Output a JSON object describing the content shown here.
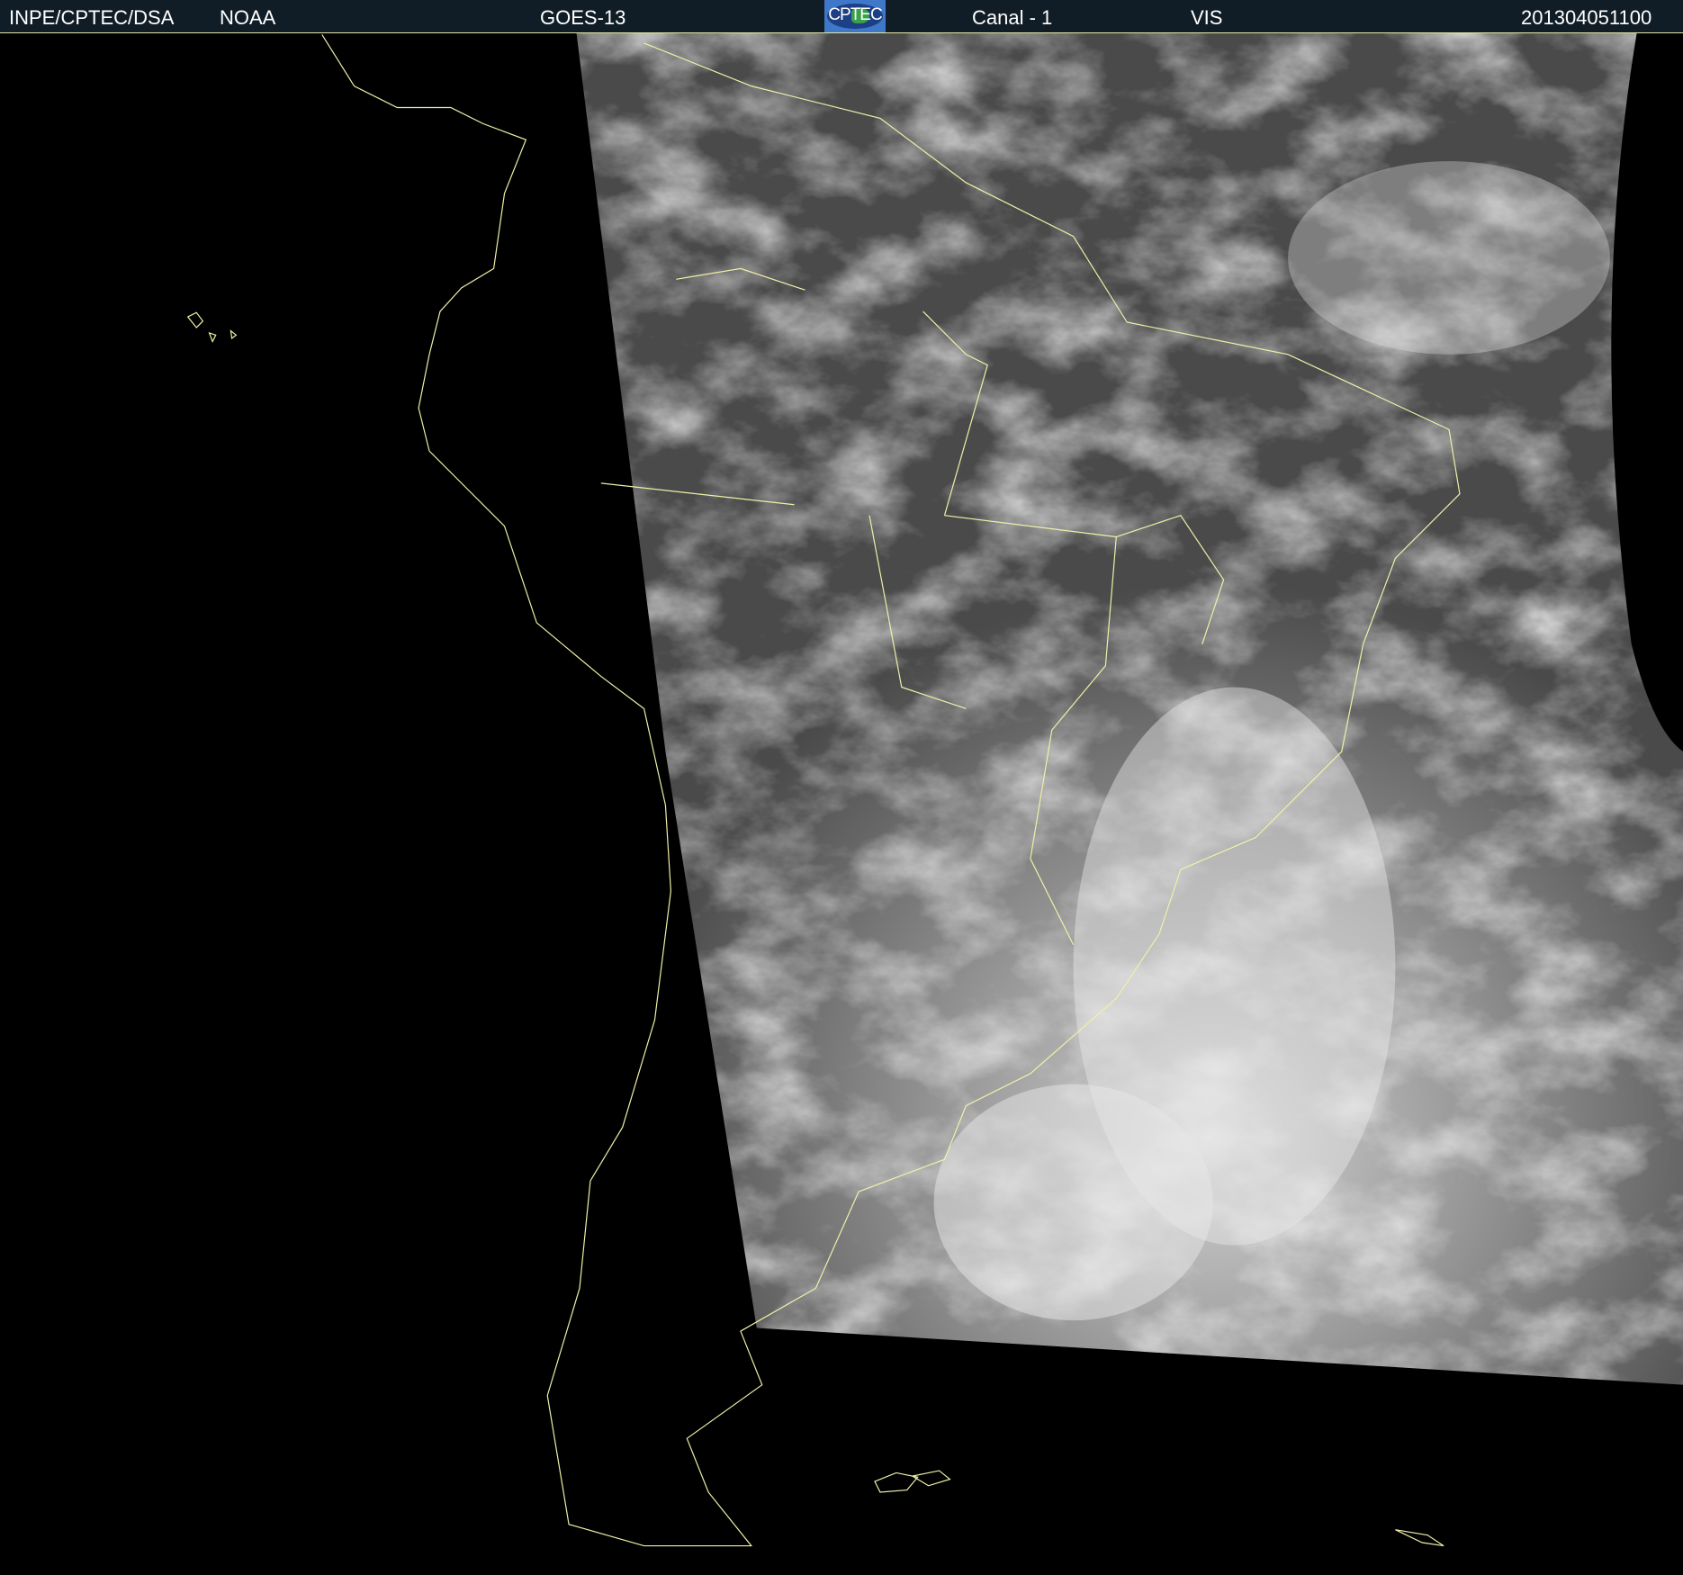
{
  "header": {
    "institution": "INPE/CPTEC/DSA",
    "agency": "NOAA",
    "satellite": "GOES-13",
    "logo_text": "CPTEC",
    "channel": "Canal - 1",
    "band": "VIS",
    "timestamp": "201304051100"
  },
  "colors": {
    "header_bg": "#111d26",
    "coastline": "#f0f0a8",
    "space": "#000000"
  }
}
